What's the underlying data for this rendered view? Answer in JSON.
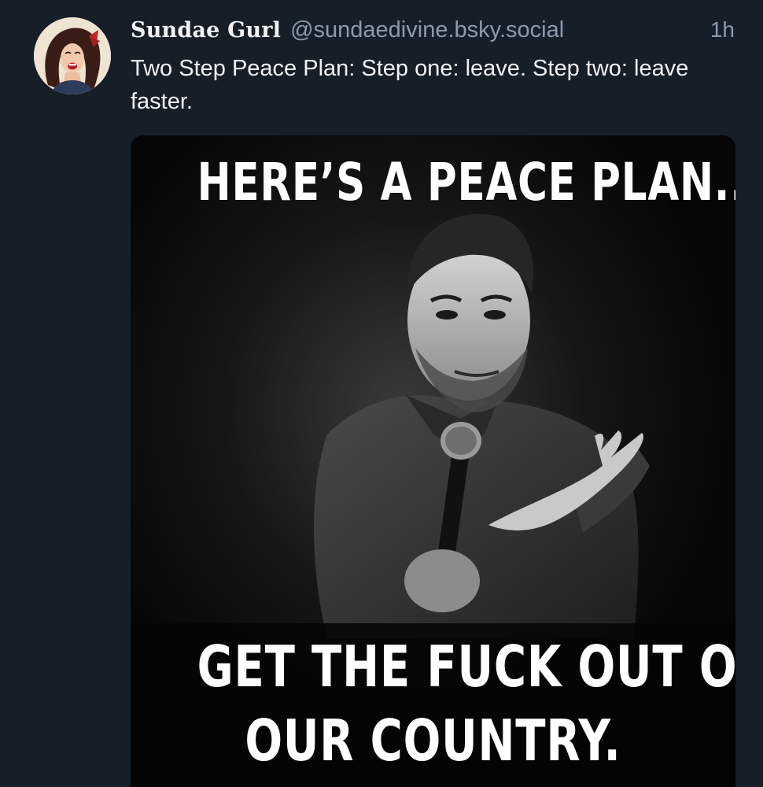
{
  "post": {
    "author": {
      "display_name": "Sundae Gurl",
      "handle": "@sundaedivine.bsky.social"
    },
    "timestamp": "1h",
    "text": "Two Step Peace Plan: Step one: leave. Step two: leave faster.",
    "image": {
      "caption_top": "HERE’S A PEACE PLAN...",
      "caption_bottom_line1": "GET THE FUCK OUT OF",
      "caption_bottom_line2": "OUR COUNTRY."
    }
  },
  "colors": {
    "background": "#161e27",
    "text": "#f1f3f5",
    "muted": "#8d9aab"
  },
  "icons": {
    "avatar": "avatar-image",
    "media": "meme-photo"
  }
}
